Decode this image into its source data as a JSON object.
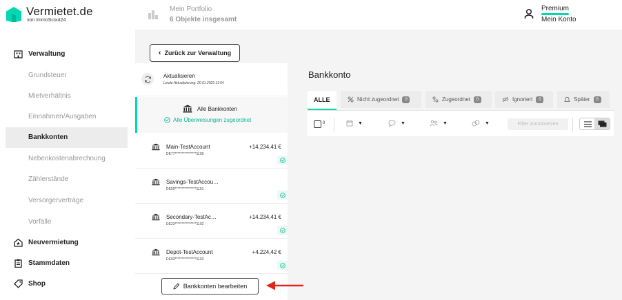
{
  "header": {
    "logo_title": "Vermietet.de",
    "logo_subtitle": "von ImmoScout24",
    "portfolio_title": "Mein Portfolio",
    "portfolio_count": "6 Objekte insgesamt",
    "premium_label": "Premium",
    "account_label": "Mein Konto",
    "accent_color": "#00d8b4"
  },
  "sidebar": {
    "sections": [
      {
        "label": "Verwaltung",
        "icon": "building-icon"
      },
      {
        "label": "Neuvermietung",
        "icon": "house-star-icon"
      },
      {
        "label": "Stammdaten",
        "icon": "clipboard-icon"
      },
      {
        "label": "Shop",
        "icon": "tag-icon"
      }
    ],
    "items": [
      {
        "label": "Grundsteuer"
      },
      {
        "label": "Mietverhältnis"
      },
      {
        "label": "Einnahmen/Ausgaben"
      },
      {
        "label": "Bankkonten",
        "active": true
      },
      {
        "label": "Nebenkostenabrechnung"
      },
      {
        "label": "Zählerstände"
      },
      {
        "label": "Versorgerverträge"
      },
      {
        "label": "Vorfälle"
      }
    ]
  },
  "back_button": "Zurück zur Verwaltung",
  "refresh": {
    "title": "Aktualisieren",
    "subtitle": "Letzte Aktualisierung: 20.01.2023 11:04"
  },
  "all_accounts": {
    "label": "Alle Bankkonten",
    "status": "Alle Überweisungen zugeordnet"
  },
  "accounts": [
    {
      "name": "Main-TestAccount",
      "iban": "DE77****************1100",
      "amount": "+14.234,41 €"
    },
    {
      "name": "Savings-TestAccou…",
      "iban": "DE59****************1101",
      "amount": ""
    },
    {
      "name": "Secondary-TestAc…",
      "iban": "DE23****************1102",
      "amount": "+14.234,41 €"
    },
    {
      "name": "Depot-TestAccount",
      "iban": "DE93****************1103",
      "amount": "+4.224,42 €"
    }
  ],
  "edit_button": "Bankkonten bearbeiten",
  "panel": {
    "title": "Bankkonto",
    "tabs": [
      {
        "label": "ALLE",
        "count": ""
      },
      {
        "label": "Nicht zugeordnet",
        "count": "0"
      },
      {
        "label": "Zugeordnet",
        "count": "0"
      },
      {
        "label": "Ignoriert",
        "count": "0"
      },
      {
        "label": "Später",
        "count": "0"
      }
    ],
    "selected_count": "0",
    "reset_filter": "Filter zurücksetzen"
  }
}
